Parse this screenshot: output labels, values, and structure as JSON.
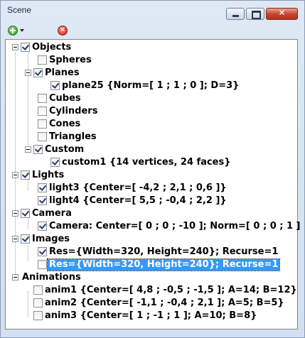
{
  "window": {
    "title": "Scene",
    "buttons": {
      "minimize": "",
      "maximize": "",
      "close": "✕"
    }
  },
  "toolbar": {
    "add_icon": "add-green-circle-icon",
    "delete_icon": "delete-red-circle-icon",
    "delete_glyph": "✕"
  },
  "tree": {
    "objects": {
      "label": "Objects",
      "checked": true,
      "children": [
        {
          "label": "Spheres",
          "checked": false
        },
        {
          "label": "Planes",
          "checked": true,
          "children": [
            {
              "label": "plane25 {Norm=[ 1 ; 1 ; 0 ]; D=3}",
              "checked": true
            }
          ]
        },
        {
          "label": "Cubes",
          "checked": false
        },
        {
          "label": "Cylinders",
          "checked": false
        },
        {
          "label": "Cones",
          "checked": false
        },
        {
          "label": "Triangles",
          "checked": false
        },
        {
          "label": "Custom",
          "checked": true,
          "children": [
            {
              "label": "custom1 {14 vertices, 24 faces}",
              "checked": true
            }
          ]
        }
      ]
    },
    "lights": {
      "label": "Lights",
      "checked": true,
      "children": [
        {
          "label": "light3 {Center=[ -4,2 ; 2,1 ; 0,6 ]}",
          "checked": true
        },
        {
          "label": "light4 {Center=[ 5,5 ; -0,4 ; 2,2 ]}",
          "checked": true
        }
      ]
    },
    "camera": {
      "label": "Camera",
      "checked": true,
      "children": [
        {
          "label": "Camera: Center=[ 0 ; 0 ; -10 ]; Norm=[ 0 ; 0 ; 1 ]",
          "checked": true
        }
      ]
    },
    "images": {
      "label": "Images",
      "checked": true,
      "children": [
        {
          "label": "Res={Width=320, Height=240}; Recurse=1",
          "checked": true
        },
        {
          "label": "Res={Width=320, Height=240}; Recurse=1",
          "checked": false,
          "selected": true
        }
      ]
    },
    "animations": {
      "label": "Animations",
      "checked": false,
      "children": [
        {
          "label": "anim1 {Center=[ 4,8 ; -0,5 ; -1,5 ]; A=14; B=12}",
          "checked": false
        },
        {
          "label": "anim2 {Center=[ -1,1 ; -0,4 ; 2,1 ]; A=5; B=5}",
          "checked": false
        },
        {
          "label": "anim3 {Center=[ 1 ; -1 ; 1 ]; A=10; B=8}",
          "checked": false
        }
      ]
    }
  },
  "colors": {
    "selection": "#3399ff",
    "window_frame": "#d3e0f1"
  }
}
